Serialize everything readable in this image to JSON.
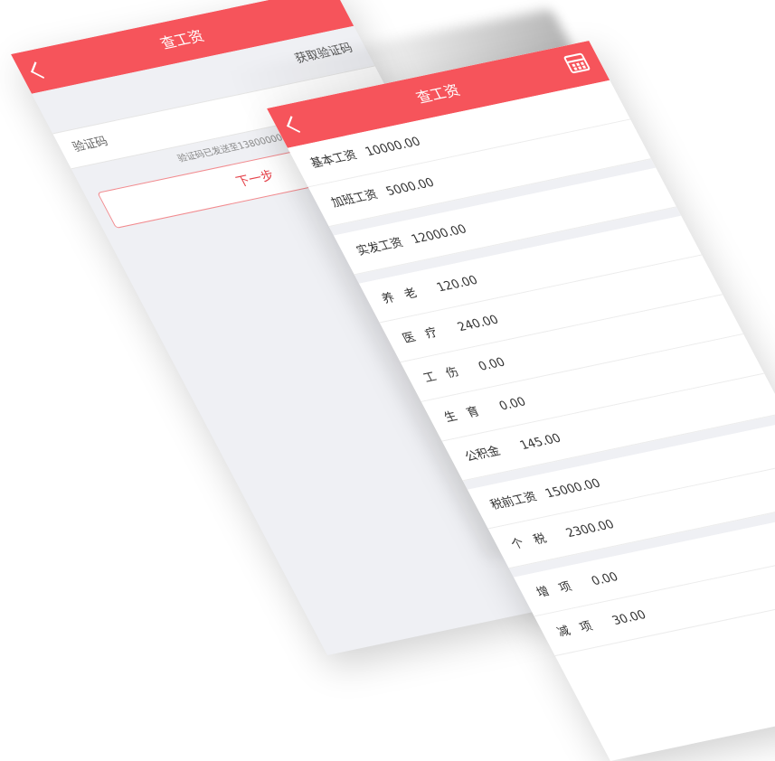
{
  "back_screen": {
    "title": "查工资",
    "get_code_label": "获取验证码",
    "verify_code_label": "验证码",
    "sent_message": "验证码已发送至13800000000",
    "next_button_label": "下一步"
  },
  "front_screen": {
    "title": "查工资",
    "back_icon": "chevron-left-icon",
    "calendar_icon": "calendar-icon",
    "groups": [
      [
        {
          "label": "基本工资",
          "value": "10000.00"
        },
        {
          "label": "加班工资",
          "value": "5000.00"
        }
      ],
      [
        {
          "label": "实发工资",
          "value": "12000.00"
        }
      ],
      [
        {
          "label": "养　老",
          "value": "120.00"
        },
        {
          "label": "医　疗",
          "value": "240.00"
        },
        {
          "label": "工　伤",
          "value": "0.00"
        },
        {
          "label": "生　育",
          "value": "0.00"
        },
        {
          "label": "公积金",
          "value": "145.00"
        }
      ],
      [
        {
          "label": "税前工资",
          "value": "15000.00"
        },
        {
          "label": "个　税",
          "value": "2300.00"
        }
      ],
      [
        {
          "label": "增　项",
          "value": "0.00"
        },
        {
          "label": "减　项",
          "value": "30.00"
        }
      ]
    ]
  },
  "colors": {
    "accent": "#f6545b",
    "page_bg": "#eff0f4"
  }
}
